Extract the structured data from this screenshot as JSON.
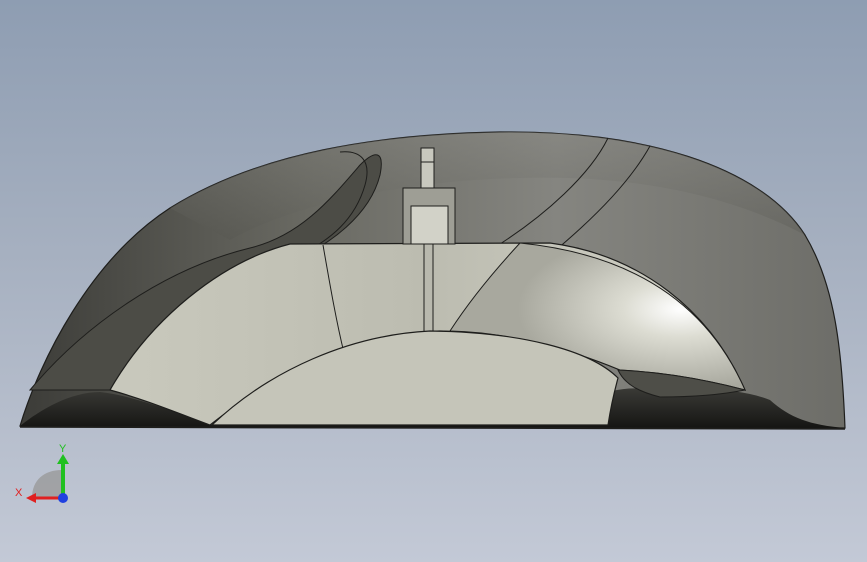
{
  "scene": {
    "model": "mouse-shell",
    "view": "front",
    "colors": {
      "background_top": "#8e9db2",
      "background_bottom": "#c3c9d6",
      "shell_dark": "#3f3f3b",
      "shell_mid": "#7a7a73",
      "face_light": "#c8c8bc",
      "edge": "#1e1e1c"
    }
  },
  "triad": {
    "x_label": "X",
    "y_label": "Y",
    "x_color": "#e02020",
    "y_color": "#20c020",
    "z_color": "#2040e0"
  }
}
